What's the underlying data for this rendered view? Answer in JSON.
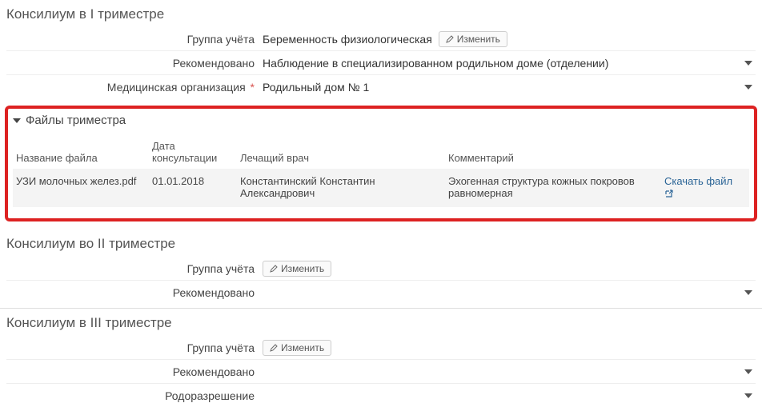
{
  "consilium1": {
    "title": "Консилиум в I триместре",
    "rows": {
      "group_label": "Группа учёта",
      "group_value": "Беременность физиологическая",
      "edit_label": "Изменить",
      "recommended_label": "Рекомендовано",
      "recommended_value": "Наблюдение в специализированном родильном доме (отделении)",
      "medorg_label": "Медицинская организация",
      "medorg_value": "Родильный дом № 1"
    }
  },
  "files": {
    "header": "Файлы триместра",
    "columns": {
      "name": "Название файла",
      "date": "Дата консультации",
      "doctor": "Лечащий врач",
      "comment": "Комментарий"
    },
    "rows": [
      {
        "name": "УЗИ молочных желез.pdf",
        "date": "01.01.2018",
        "doctor": "Константинский Константин Александрович",
        "comment": "Эхогенная структура кожных покровов равномерная",
        "download": "Скачать файл"
      }
    ]
  },
  "consilium2": {
    "title": "Консилиум во II триместре",
    "group_label": "Группа учёта",
    "edit_label": "Изменить",
    "recommended_label": "Рекомендовано"
  },
  "consilium3": {
    "title": "Консилиум в III триместре",
    "group_label": "Группа учёта",
    "edit_label": "Изменить",
    "recommended_label": "Рекомендовано",
    "delivery_label": "Родоразрешение"
  }
}
